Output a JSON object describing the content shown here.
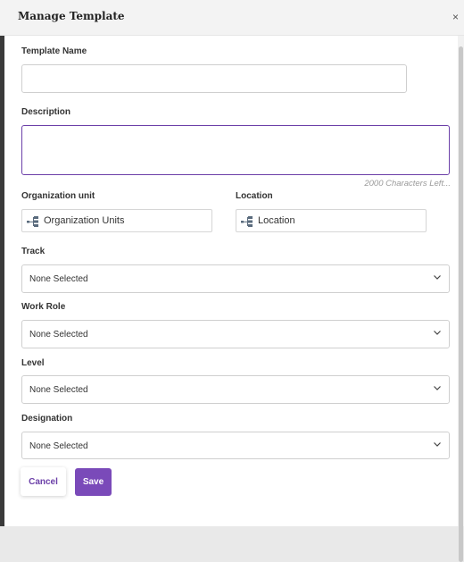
{
  "modal": {
    "title": "Manage Template",
    "close_symbol": "×"
  },
  "form": {
    "template_name": {
      "label": "Template Name",
      "value": "",
      "placeholder": ""
    },
    "description": {
      "label": "Description",
      "value": "",
      "placeholder": "",
      "char_count_text": "2000 Characters Left..."
    },
    "organization_unit": {
      "label": "Organization unit",
      "picker_text": "Organization Units",
      "icon": "tree-structure-icon"
    },
    "location": {
      "label": "Location",
      "picker_text": "Location",
      "icon": "tree-structure-icon"
    },
    "track": {
      "label": "Track",
      "selected": "None Selected"
    },
    "work_role": {
      "label": "Work Role",
      "selected": "None Selected"
    },
    "level": {
      "label": "Level",
      "selected": "None Selected"
    },
    "designation": {
      "label": "Designation",
      "selected": "None Selected"
    }
  },
  "actions": {
    "cancel_label": "Cancel",
    "save_label": "Save"
  },
  "colors": {
    "accent": "#7a4ab9",
    "accent_text": "#6b3fa8",
    "focus_border": "#6b3fa8"
  }
}
